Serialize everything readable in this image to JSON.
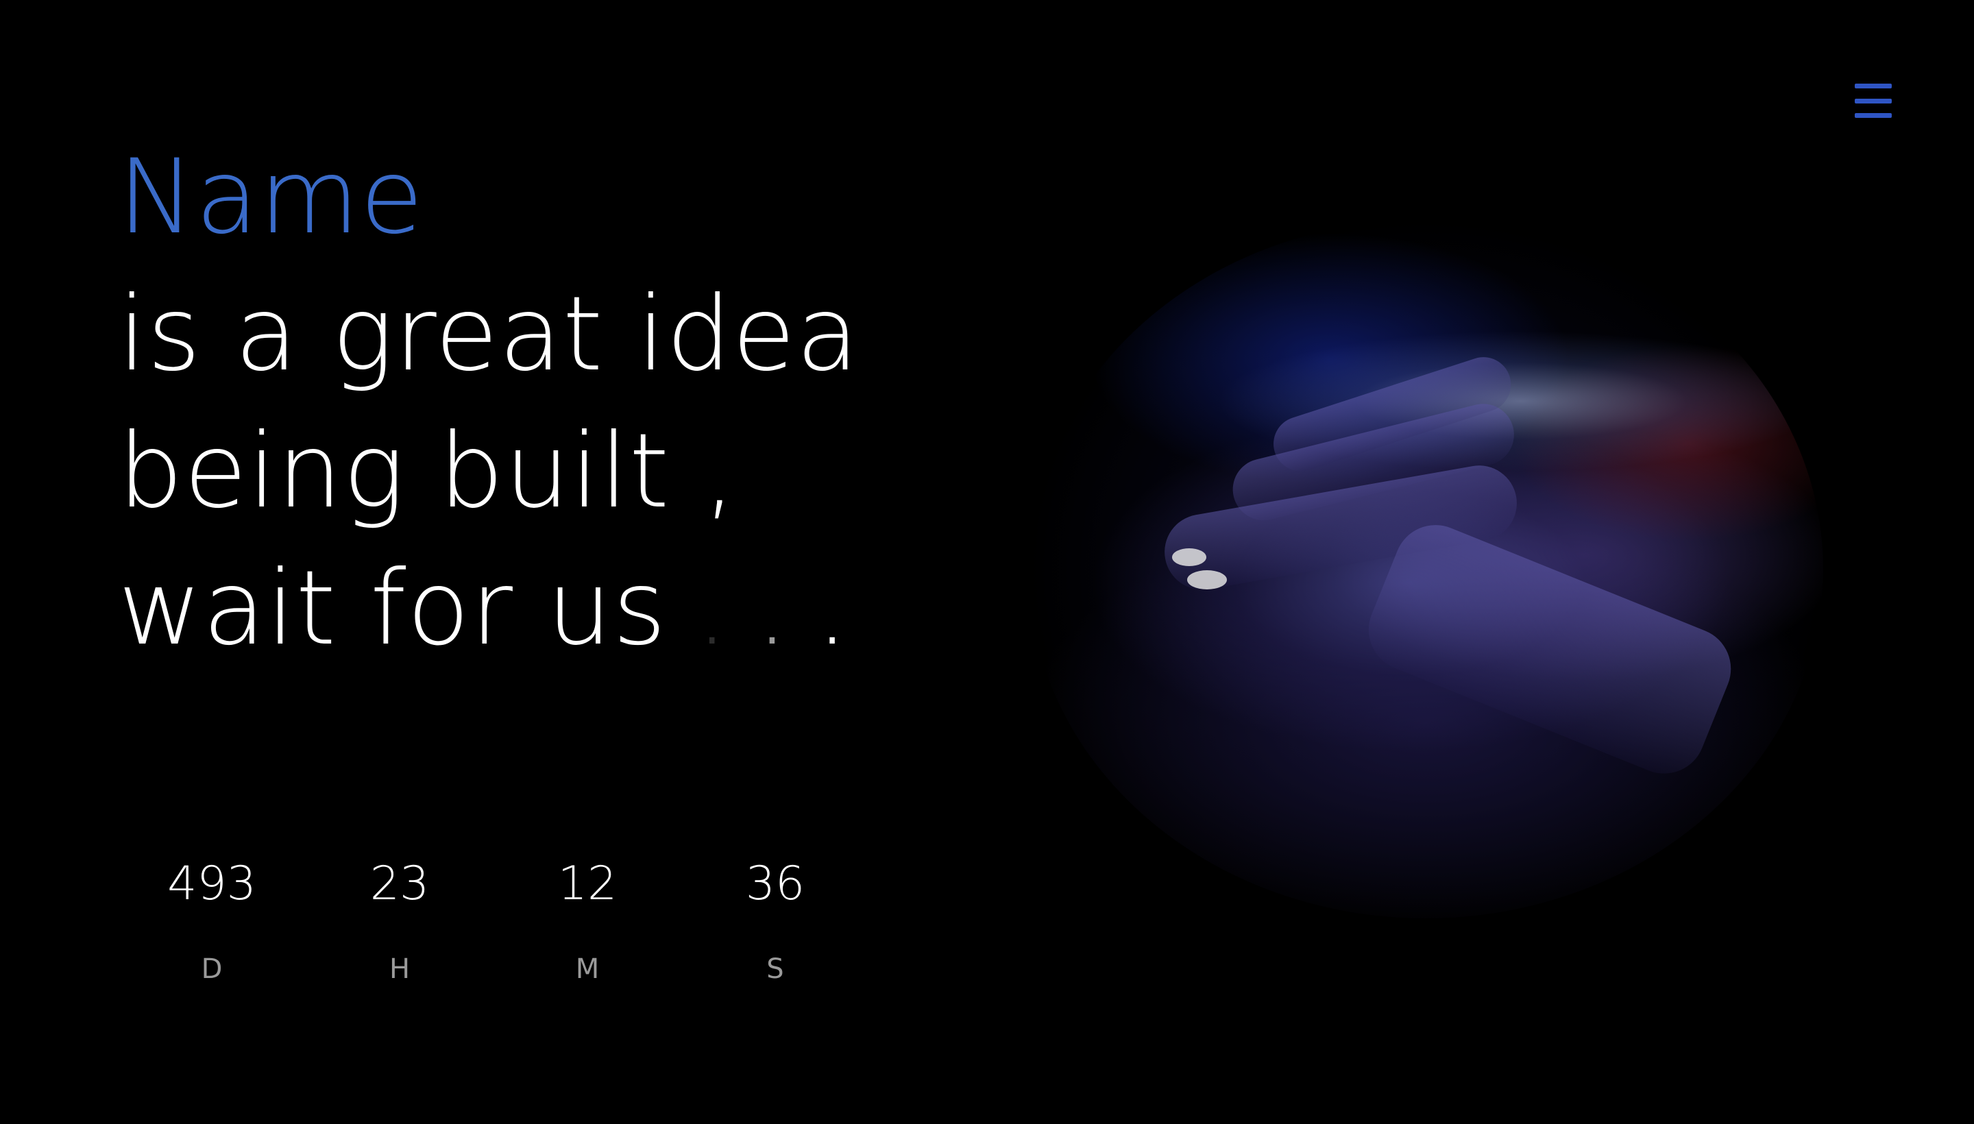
{
  "header": {
    "menu_icon": "hamburger-menu-icon",
    "accent_color": "#2f55c4"
  },
  "hero": {
    "name": "Name",
    "name_color": "#3a6bc9",
    "line1": "is a great idea",
    "line2": "being built ,",
    "line3": "wait for us",
    "dots": "...",
    "image": "hand-on-backlit-keyboard-image"
  },
  "countdown": [
    {
      "value": "493",
      "label": "D"
    },
    {
      "value": "23",
      "label": "H"
    },
    {
      "value": "12",
      "label": "M"
    },
    {
      "value": "36",
      "label": "S"
    }
  ]
}
